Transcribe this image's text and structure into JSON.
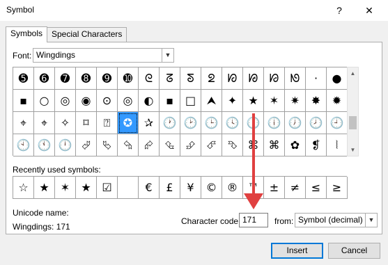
{
  "window": {
    "title": "Symbol",
    "help_label": "?",
    "close_label": "✕"
  },
  "tabs": [
    {
      "label": "Symbols",
      "active": true
    },
    {
      "label": "Special Characters",
      "active": false
    }
  ],
  "font": {
    "label": "Font:",
    "value": "Wingdings"
  },
  "grid": {
    "selected_index": 37,
    "symbols": [
      "➎",
      "➏",
      "➐",
      "➑",
      "➒",
      "➓",
      "ᘓ",
      "ᘔ",
      "ᘕ",
      "ᘖ",
      "ᘗ",
      "ᘘ",
      "ᘙ",
      "ᘚ",
      "·",
      "●",
      "▪",
      "○",
      "◎",
      "◉",
      "⊙",
      "◎",
      "◐",
      "▪",
      "□",
      "⮝",
      "✦",
      "★",
      "✶",
      "✷",
      "✸",
      "✹",
      "⌖",
      "⌖",
      "✧",
      "⌑",
      "⍰",
      "✪",
      "✰",
      "🕐",
      "🕑",
      "🕒",
      "🕓",
      "🕔",
      "🕕",
      "🕖",
      "🕗",
      "🕘",
      "🕙",
      "🕚",
      "🕛",
      "⮰",
      "⮱",
      "⮲",
      "⮳",
      "⮴",
      "⮵",
      "⮶",
      "⮷",
      "⌘",
      "⌘",
      "✿",
      "❡",
      "⦚"
    ]
  },
  "recent": {
    "label": "Recently used symbols:",
    "symbols": [
      "☆",
      "★",
      "✶",
      "★",
      "☑",
      "",
      "€",
      "£",
      "¥",
      "©",
      "®",
      "™",
      "±",
      "≠",
      "≤",
      "≥"
    ]
  },
  "unicode": {
    "label": "Unicode name:",
    "value": "Wingdings: 171"
  },
  "char_code": {
    "label": "Character code:",
    "value": "171"
  },
  "from": {
    "label": "from:",
    "value": "Symbol (decimal)"
  },
  "buttons": {
    "insert": "Insert",
    "cancel": "Cancel"
  },
  "colors": {
    "selection": "#3399ff",
    "annotation_arrow": "#e04040"
  }
}
